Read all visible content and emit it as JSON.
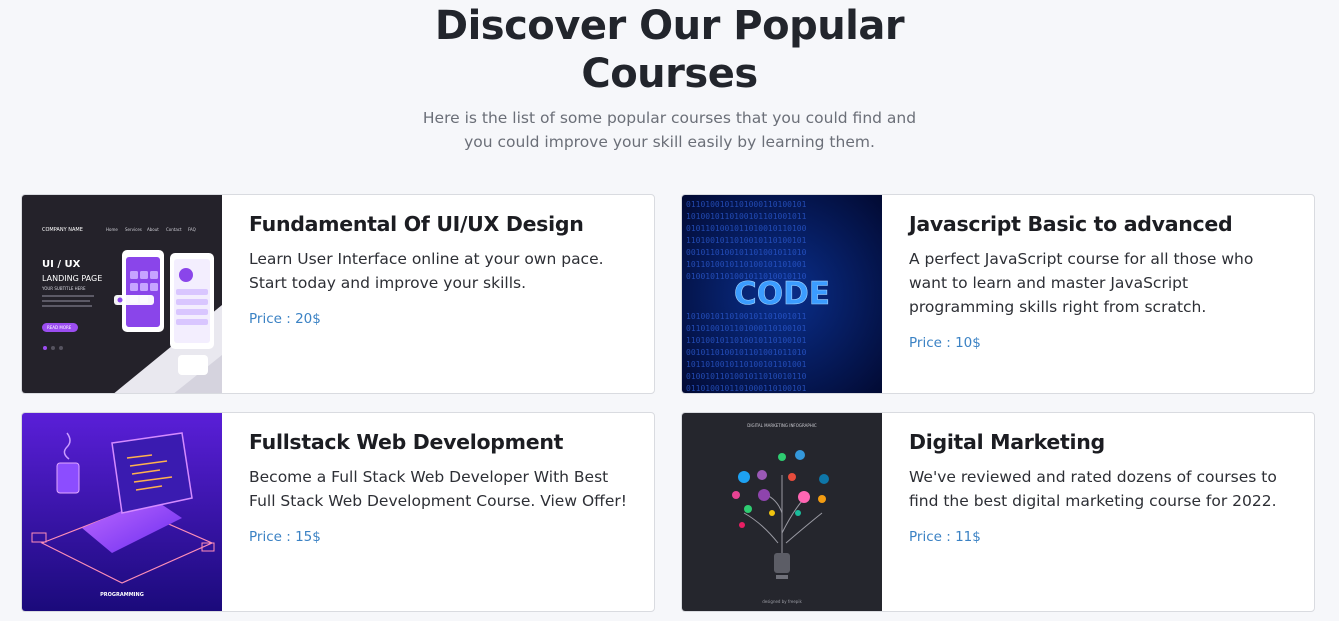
{
  "header": {
    "title_line1": "Discover Our Popular",
    "title_line2": "Courses",
    "subtitle_line1": "Here is the list of some popular courses that you could find and",
    "subtitle_line2": "you could improve your skill easily by learning them."
  },
  "courses": [
    {
      "title": "Fundamental Of UI/UX Design",
      "desc": [
        "Learn User Interface online at your own pace.",
        "Start today and improve your skills."
      ],
      "price": "Price : 20$",
      "image": {
        "nav_brand": "COMPANY NAME",
        "nav_items": [
          "Home",
          "Services",
          "About",
          "Contact",
          "FAQ"
        ],
        "hero_title": "UI / UX",
        "hero_subtitle": "LANDING PAGE",
        "hero_tagline": "YOUR SUBTITLE HERE",
        "cta": "READ MORE"
      }
    },
    {
      "title": "Javascript Basic to advanced",
      "desc": [
        "A perfect JavaScript course for all those who",
        "want to learn and master JavaScript",
        "programming skills right from scratch."
      ],
      "price": "Price : 10$",
      "image": {
        "word": "CODE"
      }
    },
    {
      "title": "Fullstack Web Development",
      "desc": [
        "Become a Full Stack Web Developer With Best",
        "Full Stack Web Development Course. View Offer!"
      ],
      "price": "Price : 15$",
      "image": {
        "caption": "PROGRAMMING"
      }
    },
    {
      "title": "Digital Marketing",
      "desc": [
        "We've reviewed and rated dozens of courses to",
        "find the best digital marketing course for 2022."
      ],
      "price": "Price : 11$",
      "image": {
        "caption": "DIGITAL MARKETING INFOGRAPHIC",
        "credit": "designed by freepik"
      }
    }
  ]
}
